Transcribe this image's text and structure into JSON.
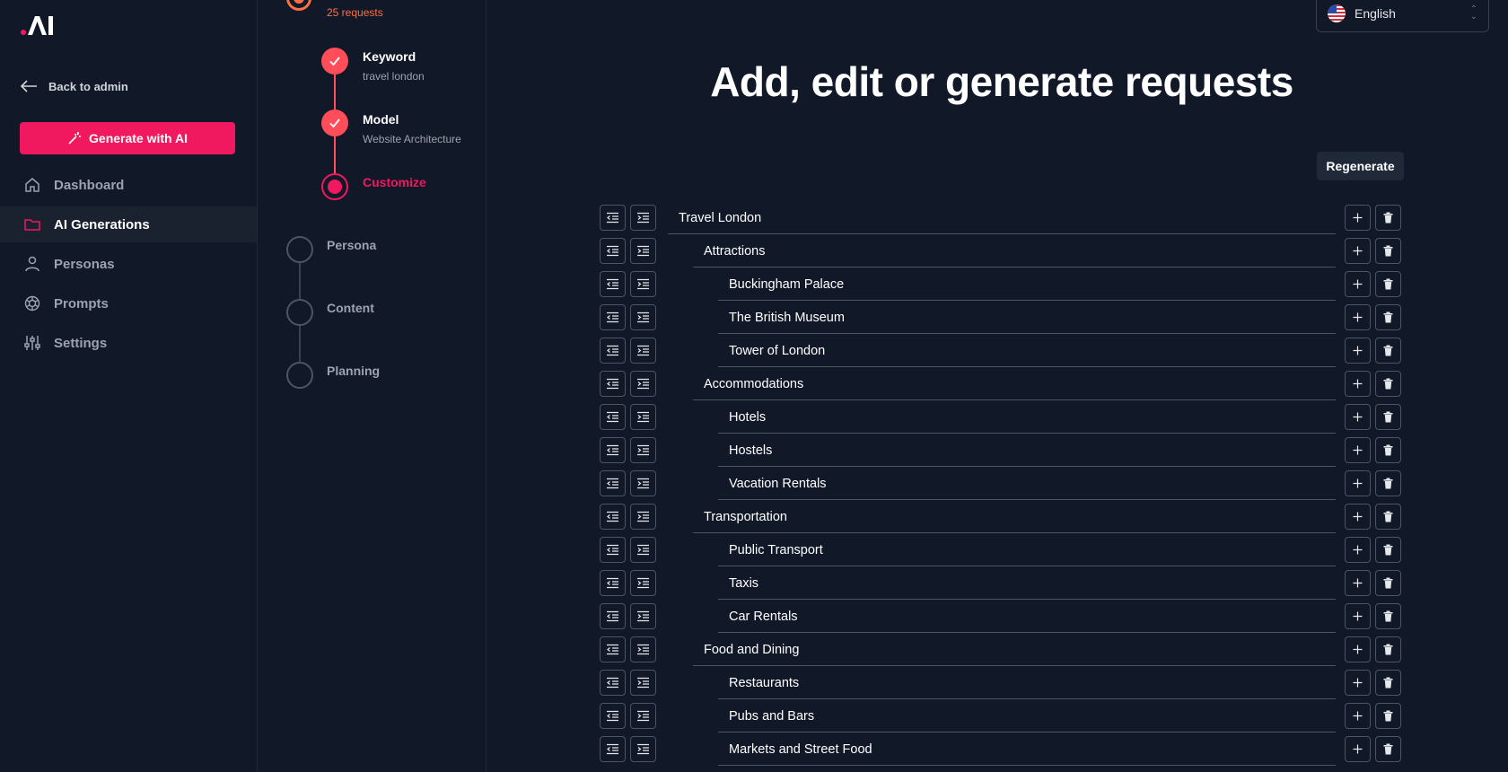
{
  "sidebar": {
    "back_label": "Back to admin",
    "generate_label": "Generate with AI",
    "nav": [
      {
        "label": "Dashboard",
        "icon": "home-icon",
        "active": false
      },
      {
        "label": "AI Generations",
        "icon": "folder-icon",
        "active": true
      },
      {
        "label": "Personas",
        "icon": "user-icon",
        "active": false
      },
      {
        "label": "Prompts",
        "icon": "openai-icon",
        "active": false
      },
      {
        "label": "Settings",
        "icon": "sliders-icon",
        "active": false
      }
    ]
  },
  "steps": {
    "request_count": "25 requests",
    "keyword": {
      "title": "Keyword",
      "value": "travel london"
    },
    "model": {
      "title": "Model",
      "value": "Website Architecture"
    },
    "current": "Customize",
    "upcoming": [
      "Persona",
      "Content",
      "Planning"
    ]
  },
  "language": {
    "selected": "English"
  },
  "main": {
    "title": "Add, edit or generate requests",
    "regenerate_label": "Regenerate",
    "tree": [
      {
        "label": "Travel London",
        "level": 0
      },
      {
        "label": "Attractions",
        "level": 1
      },
      {
        "label": "Buckingham Palace",
        "level": 2
      },
      {
        "label": "The British Museum",
        "level": 2
      },
      {
        "label": "Tower of London",
        "level": 2
      },
      {
        "label": "Accommodations",
        "level": 1
      },
      {
        "label": "Hotels",
        "level": 2
      },
      {
        "label": "Hostels",
        "level": 2
      },
      {
        "label": "Vacation Rentals",
        "level": 2
      },
      {
        "label": "Transportation",
        "level": 1
      },
      {
        "label": "Public Transport",
        "level": 2
      },
      {
        "label": "Taxis",
        "level": 2
      },
      {
        "label": "Car Rentals",
        "level": 2
      },
      {
        "label": "Food and Dining",
        "level": 1
      },
      {
        "label": "Restaurants",
        "level": 2
      },
      {
        "label": "Pubs and Bars",
        "level": 2
      },
      {
        "label": "Markets and Street Food",
        "level": 2
      }
    ]
  },
  "colors": {
    "accent": "#f0185e",
    "done": "#ff4d5a",
    "orange": "#fb7144",
    "background": "#111827"
  }
}
